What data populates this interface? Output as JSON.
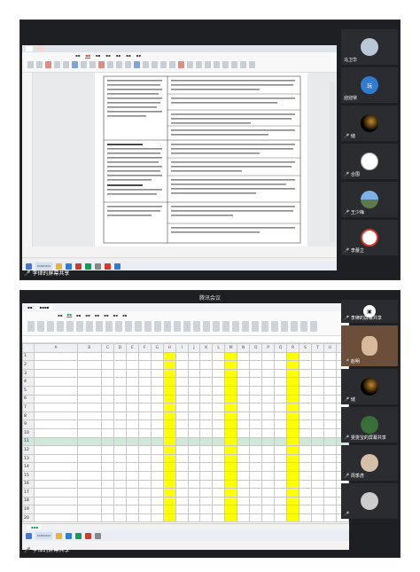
{
  "top_screen": {
    "meeting_label": "🎤 李律的屏幕共享",
    "participants": [
      {
        "name": "马卫华",
        "av": "#b9c8d6",
        "icon": ""
      },
      {
        "name": "迎迎常",
        "av": "#2f7dd1",
        "icon": "玩"
      },
      {
        "name": "🎤 储",
        "av": "#000000",
        "icon": ""
      },
      {
        "name": "🎤 合围",
        "av": "#ffffff",
        "icon": ""
      },
      {
        "name": "🎤 王少梅",
        "av": "#5a8fcf",
        "icon": ""
      },
      {
        "name": "🎤 李蕾立",
        "av": "#ffffff",
        "icon": ""
      }
    ]
  },
  "bottom_screen": {
    "window_title": "腾讯会议",
    "meeting_label": "🎤 李律的屏幕共享",
    "participants": [
      {
        "name": "🎤 李律的屏幕共享",
        "av": "#ffffff",
        "icon": ""
      },
      {
        "name": "🎤 储",
        "av": "#000000",
        "icon": ""
      },
      {
        "name": "🎤 雯雯宝的屏幕共享",
        "av": "#3a6e3a",
        "icon": ""
      },
      {
        "name": "🎤 周季虎",
        "av": "#d7c0a8",
        "icon": ""
      },
      {
        "name": "🎤",
        "av": "#cccccc",
        "icon": ""
      }
    ],
    "featured_name": "🎤 赵明"
  },
  "spreadsheet": {
    "columns": [
      "A",
      "B",
      "C",
      "D",
      "E",
      "F",
      "G",
      "H",
      "I",
      "J",
      "K",
      "L",
      "M",
      "N",
      "O",
      "P",
      "Q",
      "R",
      "S",
      "T",
      "U",
      "V"
    ],
    "yellow_columns": [
      "H",
      "M",
      "R"
    ],
    "rows": [
      {
        "n": "1",
        "a": "",
        "b": ""
      },
      {
        "n": "2",
        "a": "",
        "b": ""
      },
      {
        "n": "3",
        "a": "",
        "b": ""
      },
      {
        "n": "4",
        "a": "",
        "b": ""
      },
      {
        "n": "5",
        "a": "",
        "b": ""
      },
      {
        "n": "6",
        "a": "",
        "b": ""
      },
      {
        "n": "7",
        "a": "",
        "b": ""
      },
      {
        "n": "8",
        "a": "",
        "b": ""
      },
      {
        "n": "9",
        "a": "",
        "b": ""
      },
      {
        "n": "10",
        "a": "",
        "b": ""
      },
      {
        "n": "11",
        "a": "",
        "b": ""
      },
      {
        "n": "12",
        "a": "",
        "b": ""
      },
      {
        "n": "13",
        "a": "",
        "b": ""
      },
      {
        "n": "14",
        "a": "",
        "b": ""
      },
      {
        "n": "15",
        "a": "",
        "b": ""
      },
      {
        "n": "16",
        "a": "",
        "b": ""
      },
      {
        "n": "17",
        "a": "",
        "b": ""
      },
      {
        "n": "18",
        "a": "",
        "b": ""
      },
      {
        "n": "19",
        "a": "",
        "b": ""
      },
      {
        "n": "20",
        "a": "",
        "b": ""
      }
    ],
    "selected_row": 10
  },
  "colors": {
    "yellow": "#ffff00",
    "dark_bg": "#1e1f22",
    "tile_bg": "#2b2c30",
    "sheet_accent": "#0f9d58",
    "writer_accent": "#d13b2b"
  }
}
